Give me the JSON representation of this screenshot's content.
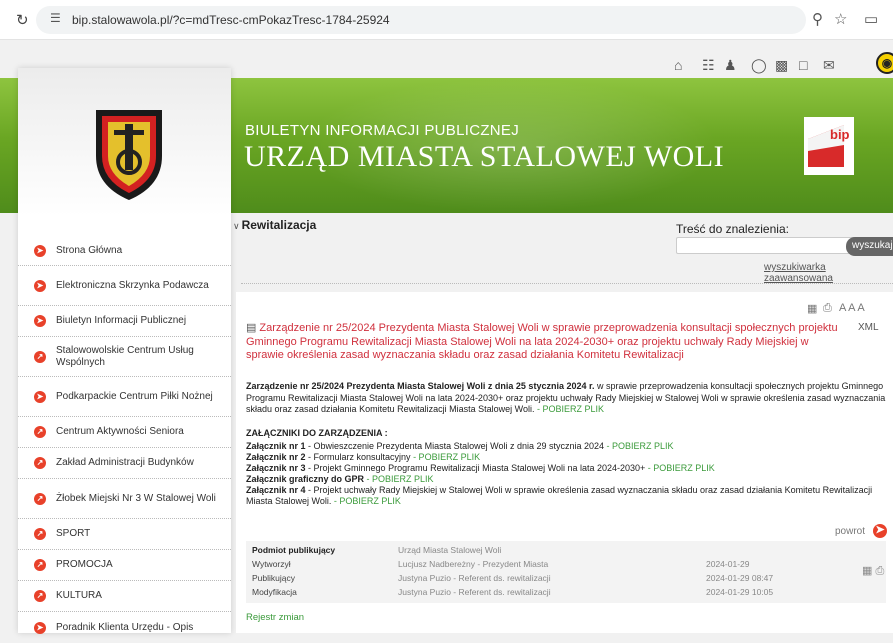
{
  "browser": {
    "url": "bip.stalowawola.pl/?c=mdTresc-cmPokazTresc-1784-25924"
  },
  "header": {
    "subtitle": "BIULETYN INFORMACJI PUBLICZNEJ",
    "title": "URZĄD MIASTA STALOWEJ WOLI",
    "bip_logo_text": "bip"
  },
  "sidebar": {
    "items": [
      {
        "label": "Strona Główna",
        "icon": "arrow-right-icon"
      },
      {
        "label": "Elektroniczna Skrzynka Podawcza",
        "icon": "arrow-right-icon"
      },
      {
        "label": "Biuletyn Informacji Publicznej",
        "icon": "arrow-right-icon"
      },
      {
        "label": "Stalowowolskie Centrum Usług Wspólnych",
        "icon": "external-link-icon"
      },
      {
        "label": "Podkarpackie Centrum Piłki Nożnej",
        "icon": "arrow-right-icon"
      },
      {
        "label": "Centrum Aktywności Seniora",
        "icon": "external-link-icon"
      },
      {
        "label": "Zakład Administracji Budynków",
        "icon": "external-link-icon"
      },
      {
        "label": "Żłobek Miejski Nr 3 W Stalowej Woli",
        "icon": "external-link-icon"
      },
      {
        "label": "SPORT",
        "icon": "external-link-icon"
      },
      {
        "label": "PROMOCJA",
        "icon": "external-link-icon"
      },
      {
        "label": "KULTURA",
        "icon": "external-link-icon"
      },
      {
        "label": "Poradnik Klienta Urzędu - Opis",
        "icon": "arrow-right-icon"
      }
    ]
  },
  "breadcrumb": "Rewitalizacja",
  "search": {
    "label": "Treść do znalezienia:",
    "button": "wyszukaj",
    "advanced": "wyszukiwarka zaawansowana"
  },
  "tools": {
    "font_sizes": "A A A",
    "xml": "XML"
  },
  "document": {
    "title": "Zarządzenie nr 25/2024 Prezydenta Miasta Stalowej Woli w sprawie przeprowadzenia konsultacji społecznych projektu Gminnego Programu Rewitalizacji Miasta Stalowej Woli na lata 2024-2030+ oraz projektu uchwały Rady Miejskiej w sprawie określenia zasad wyznaczania składu oraz zasad działania Komitetu Rewitalizacji",
    "lead_bold": "Zarządzenie nr 25/2024 Prezydenta Miasta Stalowej Woli z dnia 25 stycznia 2024 r.",
    "lead_text": " w sprawie przeprowadzenia konsultacji społecznych projektu Gminnego Programu Rewitalizacji Miasta Stalowej Woli na lata 2024-2030+ oraz projektu uchwały Rady Miejskiej w Stalowej Woli w sprawie określenia zasad wyznaczania składu oraz zasad działania Komitetu Rewitalizacji Miasta Stalowej Woli.",
    "download": " - POBIERZ PLIK",
    "attachments_header": "ZAŁĄCZNIKI DO ZARZĄDZENIA :",
    "attachments": [
      {
        "label": "Załącznik nr 1",
        "text": " - Obwieszczenie Prezydenta Miasta Stalowej Woli z dnia 29 stycznia 2024"
      },
      {
        "label": "Załącznik nr 2",
        "text": " - Formularz konsultacyjny"
      },
      {
        "label": "Załącznik nr 3",
        "text": " - Projekt Gminnego Programu Rewitalizacji Miasta Stalowej Woli na lata 2024-2030+"
      },
      {
        "label": "Załącznik graficzny do GPR",
        "text": ""
      },
      {
        "label": "Załącznik nr 4",
        "text": " - Projekt uchwały Rady Miejskiej w Stalowej Woli w sprawie określenia zasad wyznaczania składu oraz zasad działania Komitetu Rewitalizacji Miasta Stalowej Woli."
      }
    ],
    "back": "powrot"
  },
  "meta": {
    "rows": [
      {
        "label": "Podmiot publikujący",
        "value": "Urząd Miasta Stalowej Woli",
        "date": ""
      },
      {
        "label": "Wytworzył",
        "value": "Lucjusz Nadbereżny - Prezydent Miasta",
        "date": "2024-01-29"
      },
      {
        "label": "Publikujący",
        "value": "Justyna Puzio - Referent ds. rewitalizacji",
        "date": "2024-01-29 08:47"
      },
      {
        "label": "Modyfikacja",
        "value": "Justyna Puzio - Referent ds. rewitalizacji",
        "date": "2024-01-29 10:05"
      }
    ],
    "history_link": "Rejestr zmian"
  },
  "colors": {
    "accent_green": "#6aa623",
    "red": "#e8412a",
    "title_red": "#d0303d",
    "link_green": "#3a9a3a"
  }
}
